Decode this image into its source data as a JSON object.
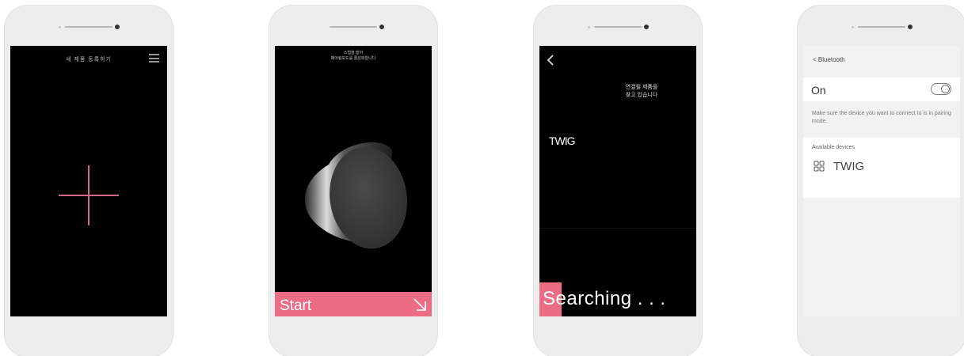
{
  "screens": {
    "register": {
      "title": "새 제품 등록하기",
      "menu_icon": "hamburger-menu-icon",
      "plus_icon": "plus-icon",
      "accent_color": "#d76684"
    },
    "pairing": {
      "instruction_line1": "스텝을 밟아",
      "instruction_line2": "페어링모드를 활성화합니다",
      "start_label": "Start",
      "arrow_icon": "arrow-down-right-icon",
      "accent_color": "#ec6c84"
    },
    "searching": {
      "back_icon": "chevron-left-icon",
      "status_line1": "연결될 제품을",
      "status_line2": "찾고 있습니다",
      "device_name": "TWIG",
      "searching_label": "Searching . . .",
      "accent_color": "#ec6c84"
    },
    "bluetooth": {
      "back_label": "< Bluetooth",
      "toggle_label": "On",
      "toggle_on": true,
      "help_text": "Make sure the device you want to connect to is in pairing mode.",
      "available_label": "Available devices",
      "device_icon": "device-grid-icon",
      "device_name": "TWIG"
    }
  }
}
